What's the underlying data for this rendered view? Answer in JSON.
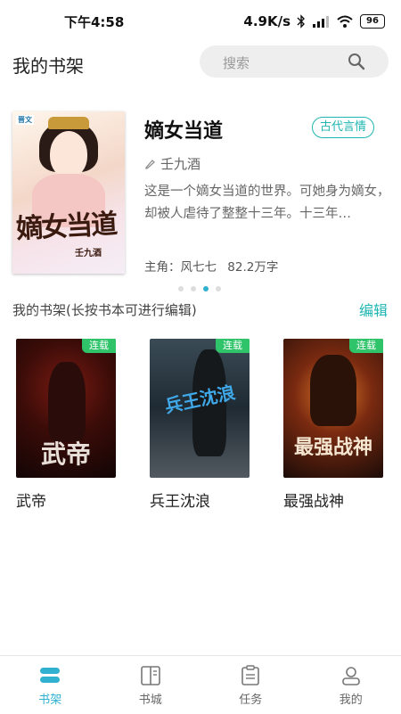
{
  "status_bar": {
    "time": "下午4:58",
    "speed": "4.9K/s",
    "battery": "96"
  },
  "header": {
    "title": "我的书架",
    "search_placeholder": "搜索"
  },
  "featured": {
    "cover_logo": "晋文",
    "cover_title": "嫡女当道",
    "cover_author": "壬九酒",
    "title": "嫡女当道",
    "tag": "古代言情",
    "author": "壬九酒",
    "description": "这是一个嫡女当道的世界。可她身为嫡女，却被人虐待了整整十三年。十三年…",
    "protagonist": "主角：风七七",
    "word_count": "82.2万字"
  },
  "carousel": {
    "count": 4,
    "active_index": 2
  },
  "shelf": {
    "title": "我的书架(长按书本可进行编辑)",
    "edit": "编辑",
    "books": [
      {
        "name": "武帝",
        "badge": "连载",
        "cover_text": "武帝"
      },
      {
        "name": "兵王沈浪",
        "badge": "连载",
        "cover_text": "兵王沈浪"
      },
      {
        "name": "最强战神",
        "badge": "连载",
        "cover_text": "最强战神"
      }
    ]
  },
  "tabbar": {
    "items": [
      {
        "label": "书架",
        "icon": "bookshelf-icon",
        "active": true
      },
      {
        "label": "书城",
        "icon": "bookstore-icon",
        "active": false
      },
      {
        "label": "任务",
        "icon": "task-icon",
        "active": false
      },
      {
        "label": "我的",
        "icon": "profile-icon",
        "active": false
      }
    ]
  },
  "colors": {
    "accent": "#1fb6b1",
    "active_tab": "#2fb1cf",
    "badge": "#2fc46a"
  }
}
